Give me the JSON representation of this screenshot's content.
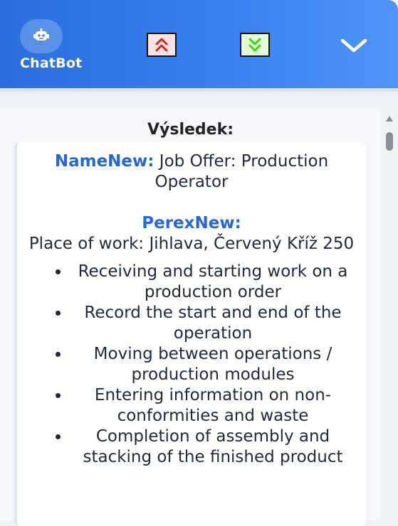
{
  "header": {
    "bot_name": "ChatBot",
    "icons": {
      "avatar": "robot-icon",
      "scroll_up": "double-chevron-up-icon",
      "scroll_down": "double-chevron-down-icon",
      "collapse": "chevron-down-icon"
    },
    "colors": {
      "gradient_start": "#2a6ee0",
      "gradient_end": "#4f95f7",
      "scroll_up_icon": "#e01b1b",
      "scroll_down_icon": "#38d40f"
    }
  },
  "result": {
    "heading": "Výsledek:",
    "name_label": "NameNew:",
    "name_value": "Job Offer: Production Operator",
    "perex_label": "PerexNew:",
    "perex_value": "Place of work: Jihlava, Červený Kříž 250",
    "tasks": [
      "Receiving and starting work on a production order",
      "Record the start and end of the operation",
      "Moving between operations / production modules",
      "Entering information on non-conformities and waste",
      "Completion of assembly and stacking of the finished product"
    ]
  }
}
